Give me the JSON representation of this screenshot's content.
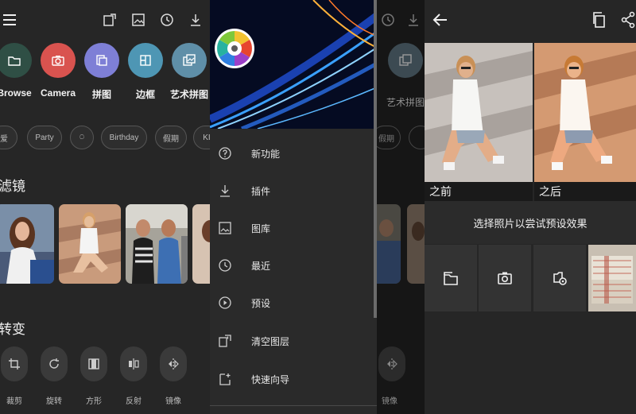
{
  "panel1": {
    "tools": [
      {
        "label": "Browse",
        "icon": "folder-icon",
        "color": "#2f4f45"
      },
      {
        "label": "Camera",
        "icon": "camera-icon",
        "color": "#d9534f"
      },
      {
        "label": "拼图",
        "icon": "collage-icon",
        "color": "#7e7fd6"
      },
      {
        "label": "边框",
        "icon": "frame-icon",
        "color": "#4e96b4"
      },
      {
        "label": "艺术拼图",
        "icon": "art-collage-icon",
        "color": "#5f8fa8"
      }
    ],
    "chips": [
      "爱",
      "Party",
      "⍥",
      "Birthday",
      "假期",
      "KI"
    ],
    "filters_title": "滤镜",
    "transform_title": "转变",
    "transforms": [
      "裁剪",
      "旋转",
      "方形",
      "反射",
      "镜像"
    ]
  },
  "drawer": {
    "items": [
      {
        "label": "新功能",
        "icon": "help-icon"
      },
      {
        "label": "插件",
        "icon": "download-icon"
      },
      {
        "label": "图库",
        "icon": "gallery-icon"
      },
      {
        "label": "最近",
        "icon": "history-icon"
      },
      {
        "label": "预设",
        "icon": "play-circle-icon"
      },
      {
        "label": "清空图层",
        "icon": "clear-layers-icon"
      },
      {
        "label": "快速向导",
        "icon": "quick-guide-icon"
      }
    ]
  },
  "panel3": {
    "tool_label": "艺术拼图",
    "chip_label": "假期",
    "mirror_label": "镜像"
  },
  "panel4": {
    "before_label": "之前",
    "after_label": "之后",
    "hint": "选择照片以尝试预设效果"
  }
}
